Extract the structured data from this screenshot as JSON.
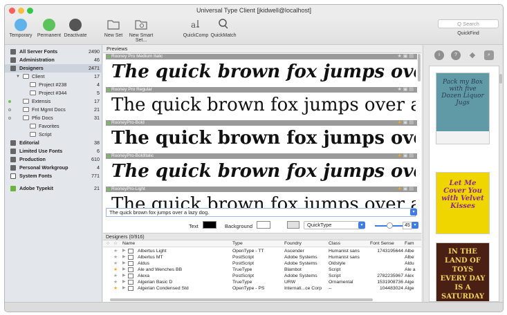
{
  "window": {
    "title": "Universal Type Client [jkidwell@localhost]"
  },
  "toolbar": {
    "items": [
      {
        "label": "Temporary",
        "icon": "temporary-activation-icon",
        "color": "#5fb3e8"
      },
      {
        "label": "Permanent",
        "icon": "permanent-activation-icon",
        "color": "#5cc35a"
      },
      {
        "label": "Deactivate",
        "icon": "deactivate-icon",
        "color": "#555555"
      },
      {
        "label": "New Set",
        "icon": "new-set-icon"
      },
      {
        "label": "New Smart Set...",
        "icon": "new-smart-set-icon"
      },
      {
        "label": "QuickComp",
        "icon": "quickcomp-icon"
      },
      {
        "label": "QuickMatch",
        "icon": "quickmatch-icon"
      }
    ],
    "search_placeholder": "Q Search",
    "quickfind_label": "QuickFind"
  },
  "sidebar": {
    "items": [
      {
        "label": "All Server Fonts",
        "count": "2490",
        "icon": "grid",
        "bold": true
      },
      {
        "label": "Administration",
        "count": "46",
        "icon": "grid",
        "bold": true
      },
      {
        "label": "Designers",
        "count": "2471",
        "icon": "grid",
        "bold": true,
        "selected": true
      },
      {
        "label": "Client",
        "count": "17",
        "icon": "folder",
        "disclosure": "▼"
      },
      {
        "label": "Project #238",
        "count": "4",
        "icon": "folder"
      },
      {
        "label": "Project #344",
        "count": "5",
        "icon": "folder"
      },
      {
        "label": "Extensis",
        "count": "17",
        "icon": "set",
        "dot": "#6ec44a"
      },
      {
        "label": "Fnt Mgmt Docs",
        "count": "21",
        "icon": "set",
        "dot": "ring"
      },
      {
        "label": "Pfio Docs",
        "count": "31",
        "icon": "set",
        "dot": "ring"
      },
      {
        "label": "Favorites",
        "count": "",
        "icon": "set"
      },
      {
        "label": "Script",
        "count": "",
        "icon": "set"
      },
      {
        "label": "Editorial",
        "count": "38",
        "icon": "grid",
        "bold": true
      },
      {
        "label": "Limited Use Fonts",
        "count": "6",
        "icon": "grid",
        "bold": true
      },
      {
        "label": "Production",
        "count": "610",
        "icon": "grid",
        "bold": true
      },
      {
        "label": "Personal Workgroup",
        "count": "4",
        "icon": "grid",
        "bold": true
      },
      {
        "label": "System Fonts",
        "count": "771",
        "icon": "monitor",
        "bold": true
      },
      {
        "label": "Adobe Typekit",
        "count": "21",
        "icon": "typekit",
        "bold": true
      }
    ]
  },
  "previews": {
    "header": "Previews",
    "sample": "The quick brown fox jumps over a lazy dog.",
    "items": [
      {
        "font": "Rooney Pro Medium Italic",
        "favorite": false
      },
      {
        "font": "Rooney Pro Regular",
        "favorite": false
      },
      {
        "font": "RooneyPro-Bold",
        "favorite": true
      },
      {
        "font": "RooneyPro-BoldItalic",
        "favorite": true
      },
      {
        "font": "RooneyPro-Light",
        "favorite": true
      }
    ]
  },
  "controls": {
    "sample_input": "The quick brown fox jumps over a lazy dog.",
    "text_label": "Text",
    "text_color": "#000000",
    "background_label": "Background",
    "background_color": "#ffffff",
    "mode": "QuickType",
    "size": "45"
  },
  "table": {
    "title": "Designers (0/916)",
    "columns": [
      "Name",
      "Type",
      "Foundry",
      "Class",
      "Font Sense",
      "Fam"
    ],
    "rows": [
      {
        "name": "Albertus Light",
        "type": "OpenType - TT",
        "foundry": "Ascender",
        "class": "Humanist sans",
        "sense": "1743195644",
        "fam": "Albe",
        "fav": false
      },
      {
        "name": "Albertus MT",
        "type": "PostScript",
        "foundry": "Adobe Systems",
        "class": "Humanist sans",
        "sense": "",
        "fam": "Albe",
        "fav": false
      },
      {
        "name": "Aldus",
        "type": "PostScript",
        "foundry": "Adobe Systems",
        "class": "Oldstyle",
        "sense": "",
        "fam": "Aldu",
        "fav": false
      },
      {
        "name": "Ale and Wenches BB",
        "type": "TrueType",
        "foundry": "Blambot",
        "class": "Script",
        "sense": "",
        "fam": "Ale a",
        "fav": true
      },
      {
        "name": "Alexa",
        "type": "PostScript",
        "foundry": "Adobe Systems",
        "class": "Script",
        "sense": "2782235967",
        "fam": "Alex",
        "fav": false
      },
      {
        "name": "Algerian Basic D",
        "type": "TrueType",
        "foundry": "URW",
        "class": "Ornamental",
        "sense": "1531908736",
        "fam": "Alge",
        "fav": false
      },
      {
        "name": "Algerian Condensed Std",
        "type": "OpenType - PS",
        "foundry": "Internati...ce Corp",
        "class": "--",
        "sense": "104483024",
        "fam": "Alge",
        "fav": true
      }
    ]
  },
  "quickfind": {
    "tabs": [
      "info-icon",
      "help-icon",
      "tag-icon",
      "quickfind-icon"
    ],
    "cards": [
      {
        "text": "Pack my Box with five Dozen Liquor Jugs",
        "bg": "#5f9aa6",
        "fg": "#2a3a55"
      },
      {
        "text": "Let Me Cover You with Velvet Kisses",
        "bg": "#f0d600",
        "fg": "#8a2a8a"
      },
      {
        "text": "IN THE LAND OF TOYS EVERY DAY IS A SATURDAY",
        "bg": "#4a2015",
        "fg": "#f2d25a"
      }
    ]
  }
}
